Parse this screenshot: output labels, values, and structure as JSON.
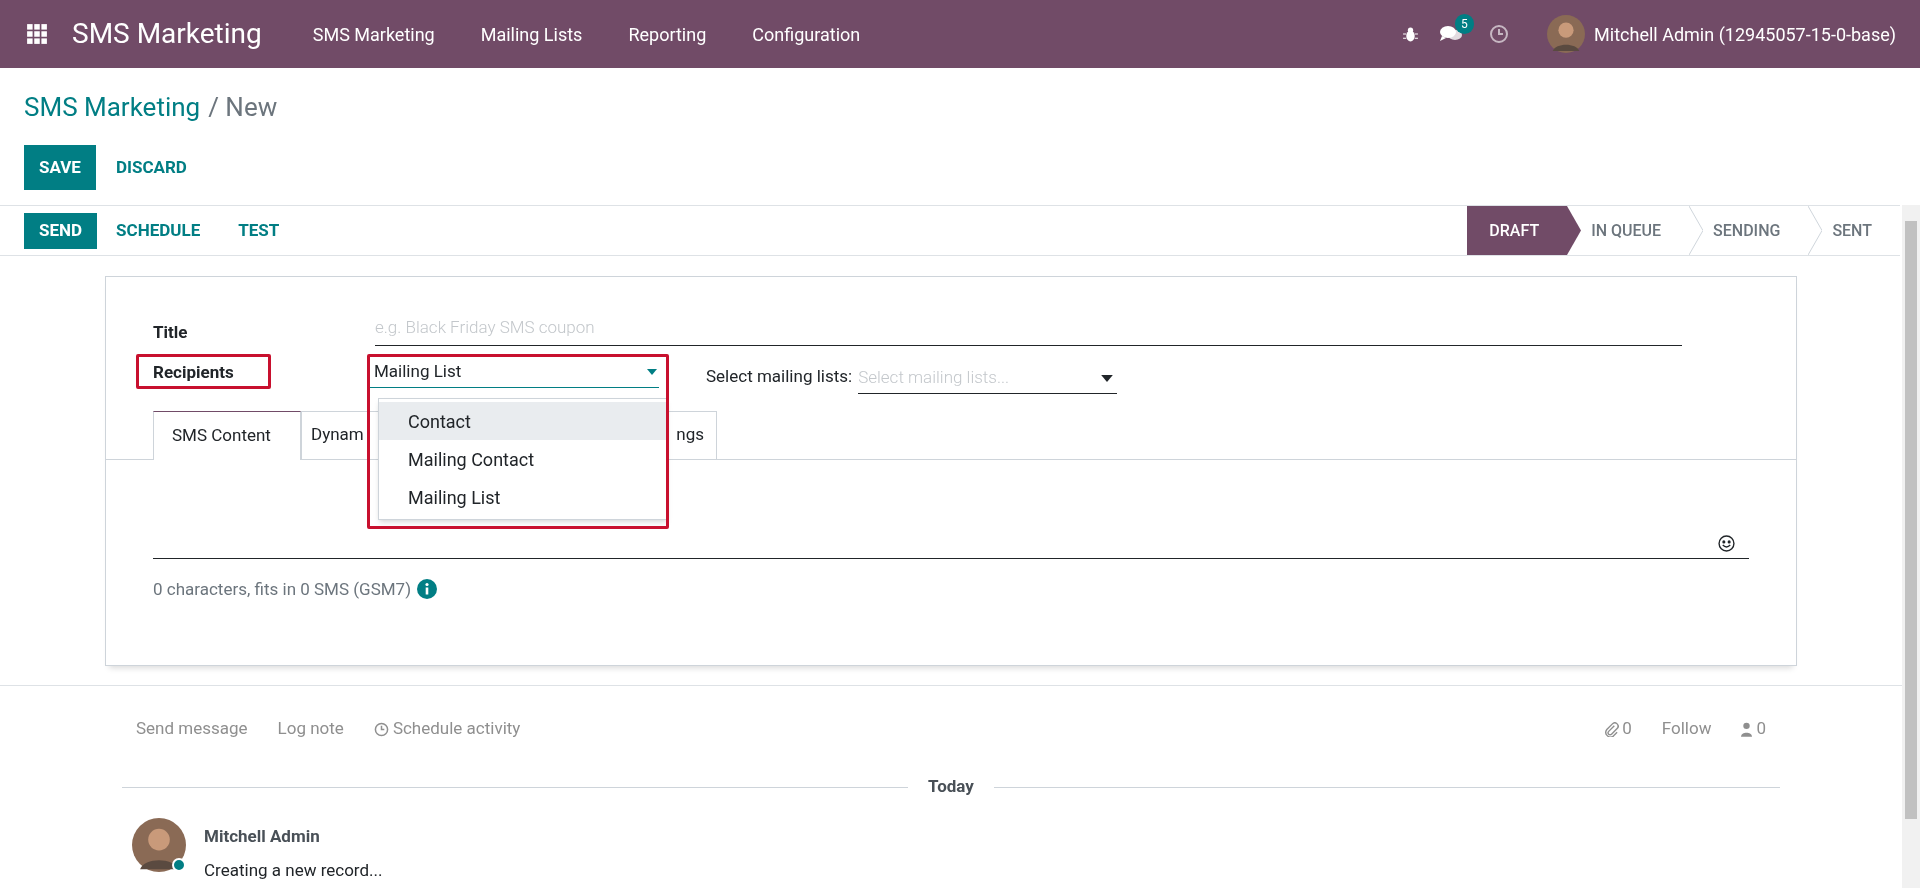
{
  "navbar": {
    "app_name": "SMS Marketing",
    "menu": [
      "SMS Marketing",
      "Mailing Lists",
      "Reporting",
      "Configuration"
    ],
    "messages_badge": "5",
    "user": "Mitchell Admin (12945057-15-0-base)"
  },
  "breadcrumb": {
    "parent": "SMS Marketing",
    "current": "/ New"
  },
  "buttons": [
    "SAVE",
    "DISCARD"
  ],
  "actions": [
    "SEND",
    "SCHEDULE",
    "TEST"
  ],
  "status_steps": [
    {
      "label": "DRAFT",
      "selected": true
    },
    {
      "label": "IN QUEUE",
      "selected": false
    },
    {
      "label": "SENDING",
      "selected": false
    },
    {
      "label": "SENT",
      "selected": false
    }
  ],
  "form": {
    "title_label": "Title",
    "title_placeholder": "e.g. Black Friday SMS coupon",
    "recipients_label": "Recipients",
    "recipients_value": "Mailing List",
    "recipients_options": [
      {
        "label": "Contact",
        "highlighted": true
      },
      {
        "label": "Mailing Contact",
        "highlighted": false
      },
      {
        "label": "Mailing List",
        "highlighted": false
      }
    ],
    "mailing_lists_label": "Select mailing lists:",
    "mailing_lists_placeholder": "Select mailing lists...",
    "tabs": [
      {
        "label": "SMS Content",
        "selected": true
      },
      {
        "label": "Dynam",
        "selected": false
      },
      {
        "label": "ngs",
        "selected": false
      }
    ],
    "char_count": "0 characters, fits in 0 SMS (GSM7)"
  },
  "chatter": {
    "actions": [
      "Send message",
      "Log note",
      "Schedule activity"
    ],
    "attachments": "0",
    "follow": "Follow",
    "followers": "0",
    "date_divider": "Today",
    "messages": [
      {
        "author": "Mitchell Admin",
        "body": "Creating a new record..."
      }
    ]
  }
}
